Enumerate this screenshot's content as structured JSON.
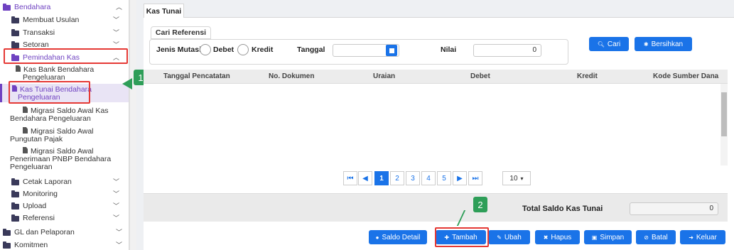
{
  "sidebar": {
    "items": [
      {
        "label": "Bendahara"
      },
      {
        "label": "Membuat Usulan"
      },
      {
        "label": "Transaksi"
      },
      {
        "label": "Setoran"
      },
      {
        "label": "Pemindahan Kas"
      },
      {
        "label": "Kas Bank Bendahara Pengeluaran"
      },
      {
        "label": "Kas Tunai Bendahara Pengeluaran"
      },
      {
        "label": "Migrasi Saldo Awal Kas Bendahara Pengeluaran"
      },
      {
        "label": "Migrasi Saldo Awal Pungutan Pajak"
      },
      {
        "label": "Migrasi Saldo Awal Penerimaan PNBP Bendahara Pengeluaran"
      },
      {
        "label": "Cetak Laporan"
      },
      {
        "label": "Monitoring"
      },
      {
        "label": "Upload"
      },
      {
        "label": "Referensi"
      },
      {
        "label": "GL dan Pelaporan"
      },
      {
        "label": "Komitmen"
      }
    ]
  },
  "badges": {
    "one": "1",
    "two": "2"
  },
  "main": {
    "tab": "Kas Tunai",
    "filter": {
      "legend": "Cari Referensi",
      "jenis_label": "Jenis Mutasi",
      "debet": "Debet",
      "kredit": "Kredit",
      "tanggal": "Tanggal",
      "nilai": "Nilai",
      "nilai_value": "0"
    },
    "buttons": {
      "cari": "Cari",
      "bersihkan": "Bersihkan"
    },
    "table": {
      "columns": [
        "Tanggal Pencatatan",
        "No. Dokumen",
        "Uraian",
        "Debet",
        "Kredit",
        "Kode Sumber Dana"
      ]
    },
    "pagination": {
      "first": "⏮",
      "prev": "◀",
      "pages": [
        "1",
        "2",
        "3",
        "4",
        "5"
      ],
      "next": "▶",
      "last": "⏭",
      "per_page": "10"
    },
    "total": {
      "label": "Total Saldo Kas Tunai",
      "value": "0"
    },
    "actions": {
      "saldo": "Saldo Detail",
      "tambah": "Tambah",
      "ubah": "Ubah",
      "hapus": "Hapus",
      "simpan": "Simpan",
      "batal": "Batal",
      "keluar": "Keluar"
    }
  }
}
